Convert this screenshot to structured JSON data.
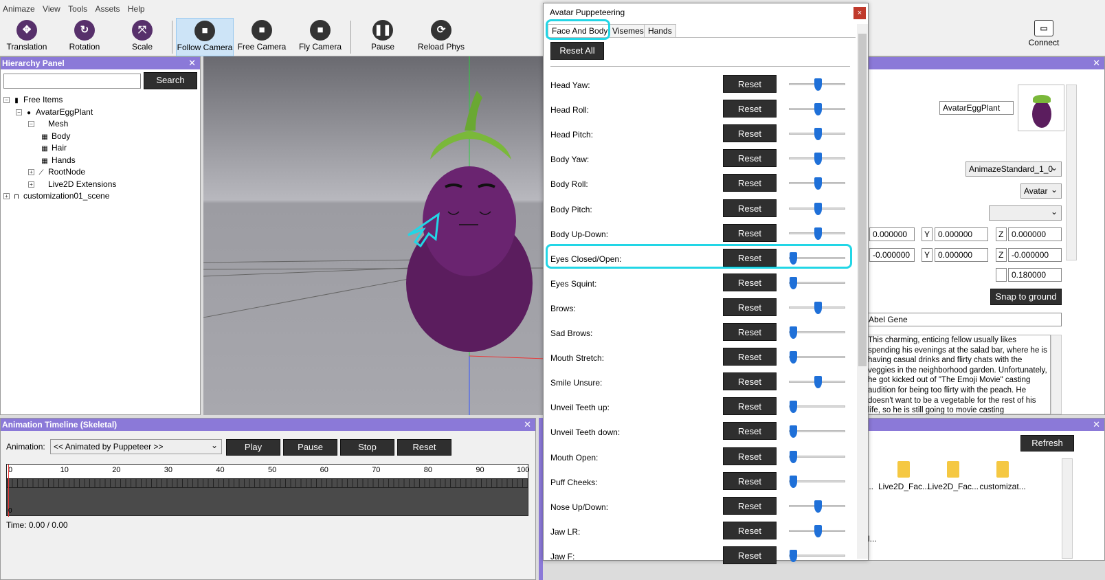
{
  "menu": [
    "Animaze",
    "View",
    "Tools",
    "Assets",
    "Help"
  ],
  "toolbar": {
    "translation": "Translation",
    "rotation": "Rotation",
    "scale": "Scale",
    "follow_camera": "Follow Camera",
    "free_camera": "Free Camera",
    "fly_camera": "Fly Camera",
    "pause": "Pause",
    "reload_phys": "Reload Phys",
    "connect": "Connect"
  },
  "hierarchy": {
    "title": "Hierarchy Panel",
    "search_label": "Search",
    "items": [
      "Free Items",
      "AvatarEggPlant",
      "Mesh",
      "Body",
      "Hair",
      "Hands",
      "RootNode",
      "Live2D Extensions",
      "customization01_scene"
    ]
  },
  "timeline": {
    "title": "Animation Timeline (Skeletal)",
    "animation_label": "Animation:",
    "animation_value": "<< Animated by Puppeteer >>",
    "play": "Play",
    "pause": "Pause",
    "stop": "Stop",
    "reset": "Reset",
    "ticks": [
      "0",
      "10",
      "20",
      "30",
      "40",
      "50",
      "60",
      "70",
      "80",
      "90",
      "100"
    ],
    "bottom_zero": "0",
    "time": "Time: 0.00 / 0.00"
  },
  "puppet": {
    "title": "Avatar Puppeteering",
    "close": "×",
    "tabs": [
      "Face And Body",
      "Visemes",
      "Hands"
    ],
    "reset_all": "Reset All",
    "reset": "Reset",
    "rows": [
      {
        "label": "Head Yaw:",
        "value": 0.5
      },
      {
        "label": "Head Roll:",
        "value": 0.5
      },
      {
        "label": "Head Pitch:",
        "value": 0.5
      },
      {
        "label": "Body Yaw:",
        "value": 0.5
      },
      {
        "label": "Body Roll:",
        "value": 0.5
      },
      {
        "label": "Body Pitch:",
        "value": 0.5
      },
      {
        "label": "Body Up-Down:",
        "value": 0.5
      },
      {
        "label": "Eyes Closed/Open:",
        "value": 0.0
      },
      {
        "label": "Eyes Squint:",
        "value": 0.0
      },
      {
        "label": "Brows:",
        "value": 0.5
      },
      {
        "label": "Sad Brows:",
        "value": 0.0
      },
      {
        "label": "Mouth Stretch:",
        "value": 0.0
      },
      {
        "label": "Smile Unsure:",
        "value": 0.5
      },
      {
        "label": "Unveil Teeth up:",
        "value": 0.0
      },
      {
        "label": "Unveil Teeth down:",
        "value": 0.0
      },
      {
        "label": "Mouth Open:",
        "value": 0.0
      },
      {
        "label": "Puff Cheeks:",
        "value": 0.0
      },
      {
        "label": "Nose Up/Down:",
        "value": 0.5
      },
      {
        "label": "Jaw LR:",
        "value": 0.5
      },
      {
        "label": "Jaw F:",
        "value": 0.0
      }
    ]
  },
  "props": {
    "name": "AvatarEggPlant",
    "standard": "AnimazeStandard_1_0",
    "type": "Avatar",
    "pos": [
      "0.000000",
      "Y",
      "0.000000",
      "Z",
      "0.000000"
    ],
    "rot": [
      "-0.000000",
      "Y",
      "0.000000",
      "Z",
      "-0.000000"
    ],
    "scale": "0.180000",
    "snap": "Snap to ground",
    "author": "Abel Gene",
    "description": "This charming, enticing fellow usually likes spending his evenings at the salad bar, where he is having casual drinks and flirty chats with the veggies in the neighborhood garden. Unfortunately, he got kicked out of \"The Emoji Movie\" casting audition for being too flirty with the peach. He doesn't want to be a vegetable for the rest of his life, so he is still going to movie casting"
  },
  "assets": {
    "refresh": "Refresh",
    "folders": [
      "c...",
      "Live2D_Fac...",
      "Live2D_Fac...",
      "customizat..."
    ],
    "bottom": "l..."
  }
}
